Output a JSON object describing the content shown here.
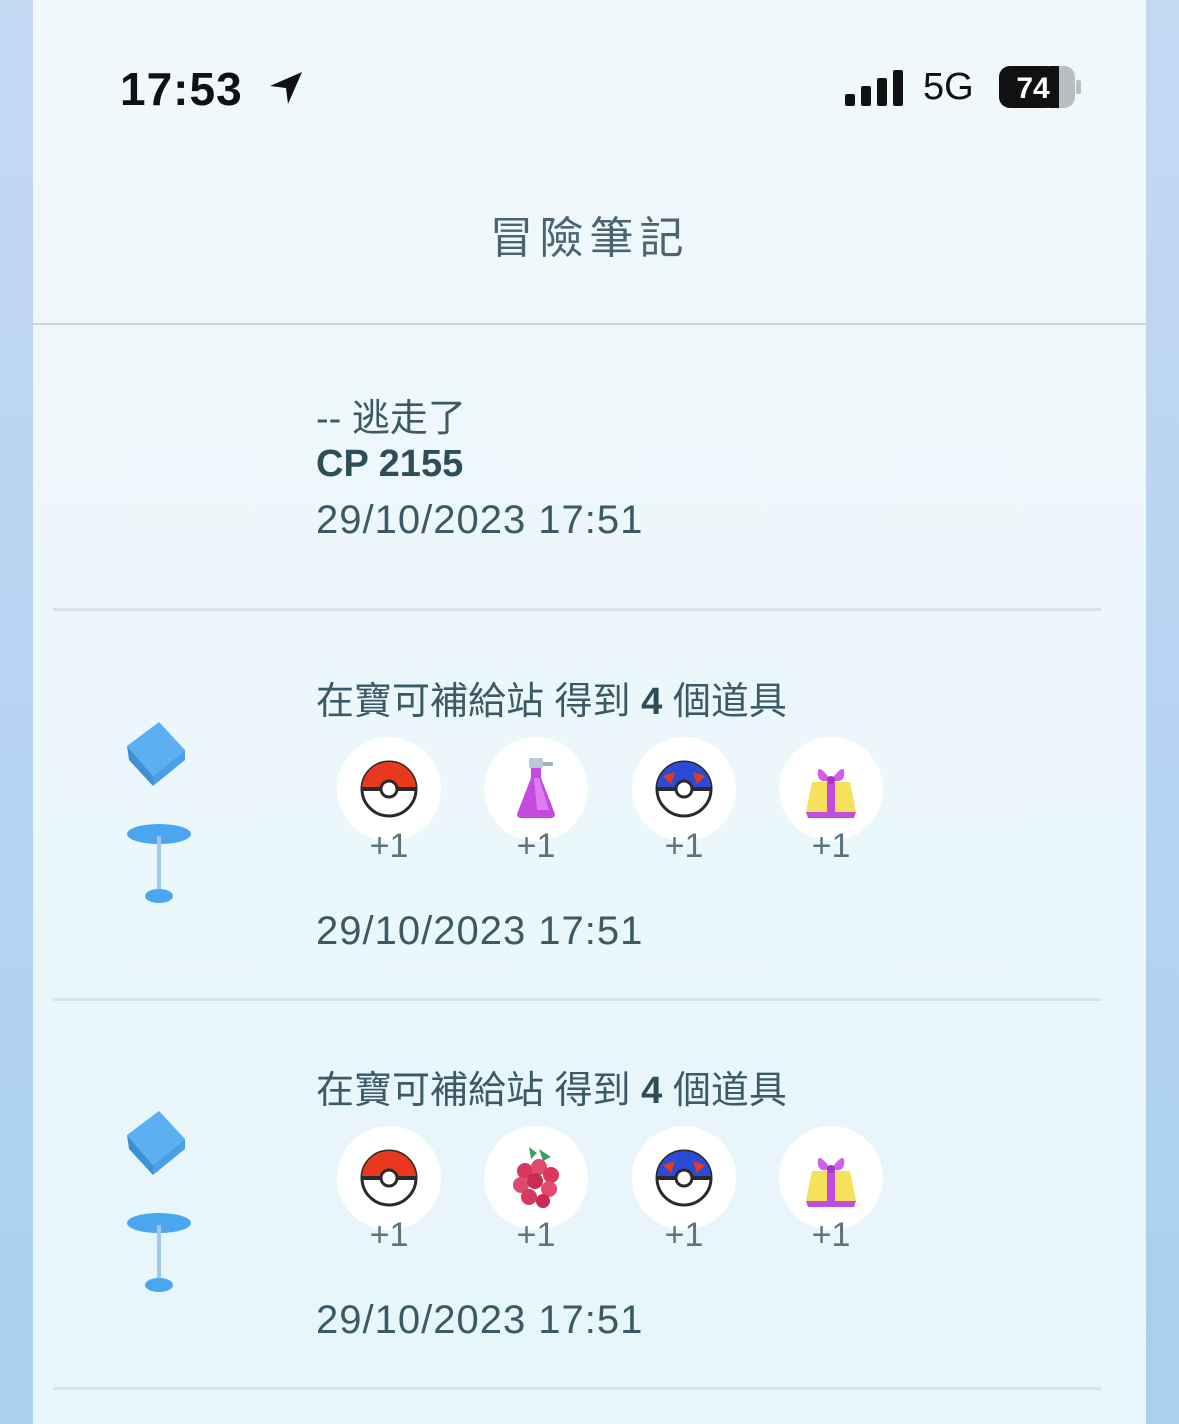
{
  "status_bar": {
    "time": "17:53",
    "network": "5G",
    "battery": "74"
  },
  "header": {
    "title": "冒險筆記"
  },
  "entries": [
    {
      "line1": "-- 逃走了",
      "cp_label": "CP",
      "cp_value": "2155",
      "date": "29/10/2023 17:51"
    },
    {
      "prefix": "在寶可補給站 得到",
      "count": "4",
      "suffix": "個道具",
      "items": [
        {
          "icon": "poke-ball-icon",
          "qty": "+1"
        },
        {
          "icon": "potion-icon",
          "qty": "+1"
        },
        {
          "icon": "great-ball-icon",
          "qty": "+1"
        },
        {
          "icon": "gift-icon",
          "qty": "+1"
        }
      ],
      "date": "29/10/2023 17:51"
    },
    {
      "prefix": "在寶可補給站 得到",
      "count": "4",
      "suffix": "個道具",
      "items": [
        {
          "icon": "poke-ball-icon",
          "qty": "+1"
        },
        {
          "icon": "razz-berry-icon",
          "qty": "+1"
        },
        {
          "icon": "great-ball-icon",
          "qty": "+1"
        },
        {
          "icon": "gift-icon",
          "qty": "+1"
        }
      ],
      "date": "29/10/2023 17:51"
    }
  ]
}
